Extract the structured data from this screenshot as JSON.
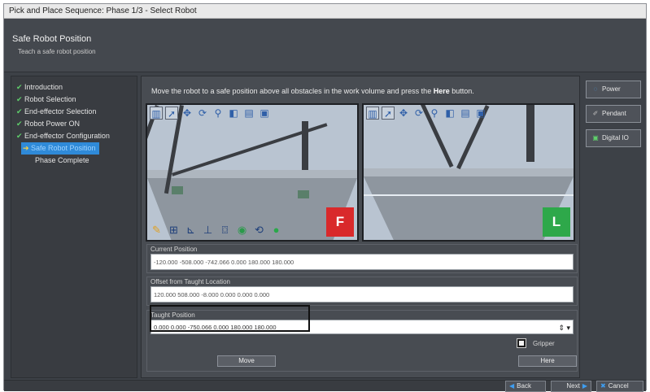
{
  "window": {
    "title": "Pick and Place Sequence: Phase 1/3 - Select Robot"
  },
  "header": {
    "title": "Safe Robot Position",
    "subtitle": "Teach a safe robot position"
  },
  "steps": [
    {
      "label": "Introduction",
      "done": true
    },
    {
      "label": "Robot Selection",
      "done": true
    },
    {
      "label": "End-effector Selection",
      "done": true
    },
    {
      "label": "Robot Power ON",
      "done": true
    },
    {
      "label": "End-effector Configuration",
      "done": true
    },
    {
      "label": "Safe Robot Position",
      "active": true
    },
    {
      "label": "Phase Complete"
    }
  ],
  "instruction": {
    "before": "Move the robot to a safe position above all obstacles in the work volume and press the ",
    "bold": "Here",
    "after": " button."
  },
  "views": {
    "left_badge": "F",
    "right_badge": "L",
    "toolbar_icons": [
      "layout-icon",
      "pointer-icon",
      "pan-icon",
      "rotate-icon",
      "zoom-icon",
      "cube-icon",
      "clipboard-icon",
      "camera-icon"
    ],
    "bottom_icons": [
      "edit-icon",
      "measure-icon",
      "axis-icon",
      "align-icon",
      "cylinder-icon",
      "grip-icon",
      "reset-icon",
      "sphere-icon"
    ]
  },
  "current_position": {
    "label": "Current Position",
    "value": "-120.000 -508.000 -742.066 0.000 180.000 180.000"
  },
  "offset": {
    "label": "Offset from Taught Location",
    "value": "120.000 508.000 -8.000 0.000 0.000 0.000"
  },
  "taught_position": {
    "label": "Taught Position",
    "value": "0.000 0.000 -750.066 0.000 180.000 180.000"
  },
  "gripper_label": "Gripper",
  "buttons": {
    "move": "Move",
    "here": "Here"
  },
  "side_buttons": {
    "power": "Power",
    "pendant": "Pendant",
    "digital_io": "Digital IO"
  },
  "footer": {
    "back": "Back",
    "next": "Next",
    "cancel": "Cancel"
  },
  "colors": {
    "accent": "#2f8ad8",
    "check": "#5fd06b",
    "flag_f": "#d9292b",
    "flag_l": "#2ea84a"
  }
}
